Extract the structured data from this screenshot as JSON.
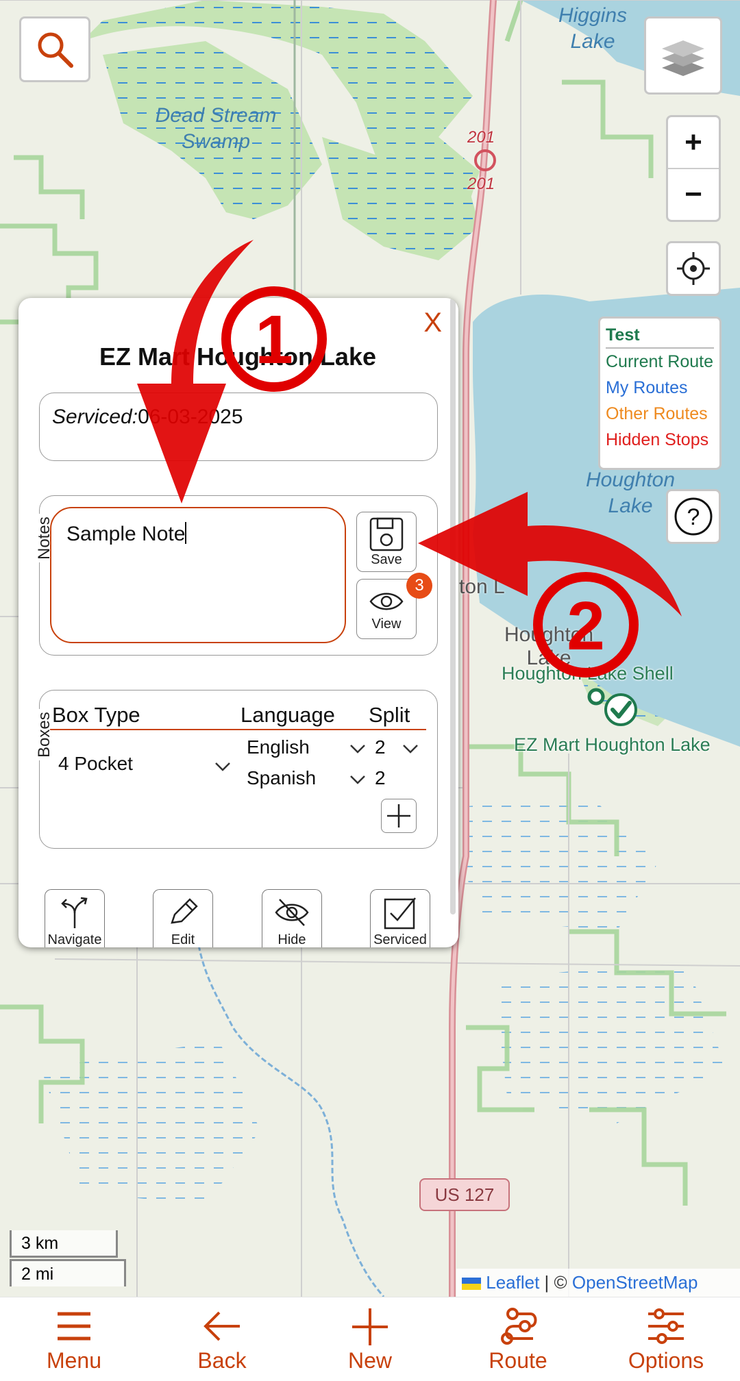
{
  "map": {
    "labels": {
      "higgins": "Higgins\nLake",
      "dead_stream": "Dead Stream\nSwamp",
      "houghton_lake": "Houghton\nLake",
      "town": "Houghton\nLake",
      "route_201a": "201",
      "route_201b": "201",
      "us127": "US 127",
      "fragment_on": "ton L"
    },
    "pois": {
      "shell": "Houghton Lake Shell",
      "ezmart": "EZ Mart Houghton Lake"
    },
    "legend": {
      "title": "Test",
      "items": [
        {
          "label": "Current Route",
          "color": "#1f7a4e"
        },
        {
          "label": "My Routes",
          "color": "#2a6fd6"
        },
        {
          "label": "Other Routes",
          "color": "#ee8a1f"
        },
        {
          "label": "Hidden Stops",
          "color": "#e0201e"
        }
      ]
    },
    "scale": {
      "km": "3 km",
      "mi": "2 mi"
    },
    "attribution": {
      "leaflet": "Leaflet",
      "sep": " | © ",
      "osm": "OpenStreetMap"
    },
    "controls": {
      "zoom_in": "+",
      "zoom_out": "−",
      "help": "?"
    }
  },
  "popup": {
    "title": "EZ Mart Houghton Lake",
    "close": "X",
    "serviced_label": "Serviced:",
    "serviced_date": "06-03-2025",
    "notes_legend": "Notes",
    "note_text": "Sample Note",
    "save_label": "Save",
    "view_label": "View",
    "view_badge": "3",
    "boxes_legend": "Boxes",
    "box_headers": {
      "type": "Box Type",
      "language": "Language",
      "split": "Split"
    },
    "box_type": "4 Pocket",
    "languages": [
      {
        "name": "English",
        "split": "2"
      },
      {
        "name": "Spanish",
        "split": "2"
      }
    ],
    "actions": {
      "navigate": "Navigate",
      "edit": "Edit",
      "hide": "Hide",
      "serviced": "Serviced"
    }
  },
  "annotations": {
    "one": "1",
    "two": "2"
  },
  "nav": {
    "items": [
      {
        "label": "Menu"
      },
      {
        "label": "Back"
      },
      {
        "label": "New"
      },
      {
        "label": "Route"
      },
      {
        "label": "Options"
      }
    ]
  },
  "colors": {
    "accent": "#c8410c",
    "water": "#aad3df",
    "wetland_green": "#c9e5b3",
    "popup_border": "#c8410c",
    "annotation_red": "#e00000"
  }
}
